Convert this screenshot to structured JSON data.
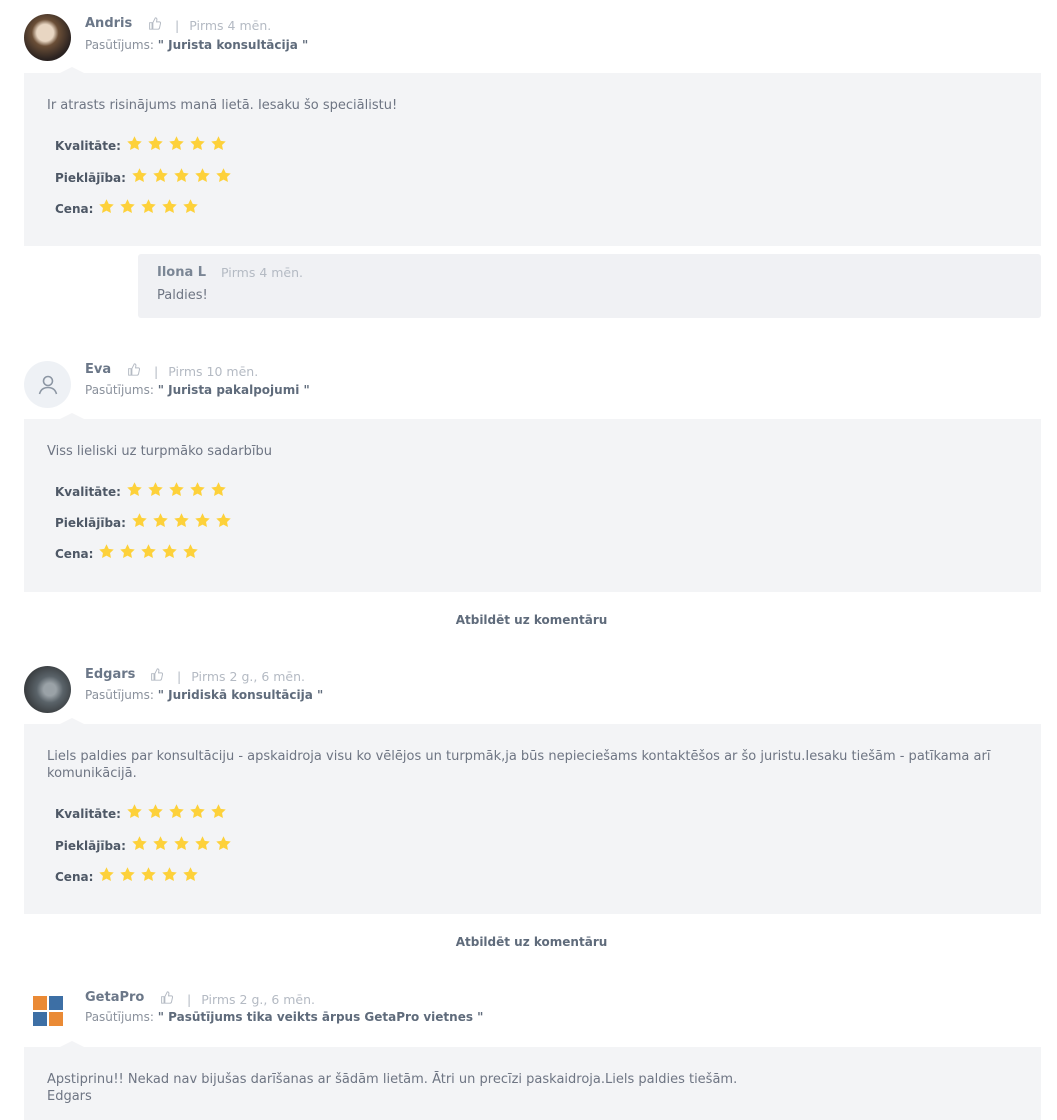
{
  "reviews": [
    {
      "name": "Andris",
      "time": "Pirms 4 mēn.",
      "order_prefix": "Pasūtījums:",
      "order_title": "\" Jurista konsultācija \"",
      "comment": "Ir atrasts risinājums manā lietā. Iesaku šo speciālistu!",
      "ratings": [
        {
          "label": "Kvalitāte:",
          "stars": 5
        },
        {
          "label": "Pieklājība:",
          "stars": 5
        },
        {
          "label": "Cena:",
          "stars": 5
        }
      ],
      "reply": {
        "name": "Ilona L",
        "time": "Pirms 4 mēn.",
        "text": "Paldies!"
      }
    },
    {
      "name": "Eva",
      "time": "Pirms 10 mēn.",
      "order_prefix": "Pasūtījums:",
      "order_title": "\" Jurista pakalpojumi \"",
      "comment": "Viss lieliski uz turpmāko sadarbību",
      "ratings": [
        {
          "label": "Kvalitāte:",
          "stars": 5
        },
        {
          "label": "Pieklājība:",
          "stars": 5
        },
        {
          "label": "Cena:",
          "stars": 5
        }
      ],
      "answer_link": "Atbildēt uz komentāru"
    },
    {
      "name": "Edgars",
      "time": "Pirms 2 g., 6 mēn.",
      "order_prefix": "Pasūtījums:",
      "order_title": "\" Juridiskā konsultācija \"",
      "comment": "Liels paldies par konsultāciju - apskaidroja visu ko vēlējos un turpmāk,ja būs nepieciešams kontaktēšos ar šo juristu.Iesaku tiešām - patīkama arī komunikācijā.",
      "ratings": [
        {
          "label": "Kvalitāte:",
          "stars": 5
        },
        {
          "label": "Pieklājība:",
          "stars": 5
        },
        {
          "label": "Cena:",
          "stars": 5
        }
      ],
      "answer_link": "Atbildēt uz komentāru"
    },
    {
      "name": "GetaPro",
      "time": "Pirms 2 g., 6 mēn.",
      "order_prefix": "Pasūtījums:",
      "order_title": "\" Pasūtījums tika veikts ārpus GetaPro vietnes \"",
      "comment": "Apstiprinu!! Nekad nav bijušas darīšanas ar šādām lietām. Ātri un precīzi paskaidroja.Liels paldies tiešām.",
      "comment_line2": "Edgars"
    }
  ],
  "icons": {
    "like": "thumbs-up-icon",
    "star": "star-icon",
    "default_avatar": "user-icon",
    "logo": "getapro-logo-icon"
  },
  "colors": {
    "star": "#fdd13a",
    "bubble": "#f3f4f6",
    "reply_bubble": "#f0f1f4",
    "logo_orange": "#ea8a35",
    "logo_blue": "#3d6fa5"
  }
}
